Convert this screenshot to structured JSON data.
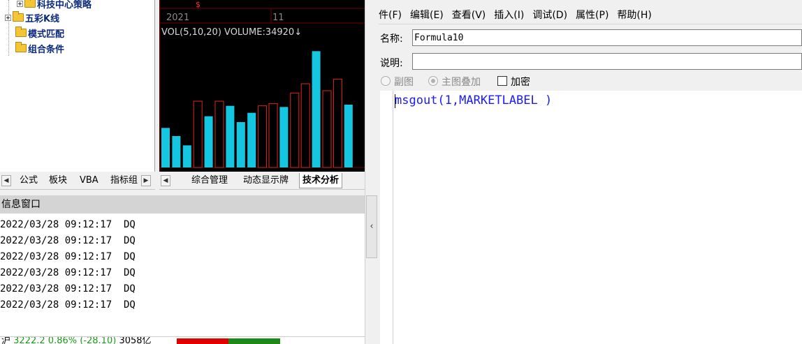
{
  "tree": {
    "items": [
      {
        "label": "科技中心策略",
        "expander": true
      },
      {
        "label": "五彩K线",
        "expander": true
      },
      {
        "label": "模式匹配",
        "expander": false
      },
      {
        "label": "组合条件",
        "expander": false
      }
    ]
  },
  "chart": {
    "year_label": "2021",
    "month_label": "11",
    "marker": "$",
    "indicator": "VOL(5,10,20) VOLUME:34920↓",
    "colors": {
      "up": "#e0251b",
      "down": "#15c6e0",
      "grid": "#7a0000"
    }
  },
  "chart_data": {
    "type": "bar",
    "series_name": "VOLUME",
    "bars": [
      {
        "value": 34,
        "kind": "down"
      },
      {
        "value": 27,
        "kind": "down"
      },
      {
        "value": 19,
        "kind": "down"
      },
      {
        "value": 57,
        "kind": "up"
      },
      {
        "value": 44,
        "kind": "down"
      },
      {
        "value": 57,
        "kind": "up"
      },
      {
        "value": 53,
        "kind": "down"
      },
      {
        "value": 39,
        "kind": "down"
      },
      {
        "value": 47,
        "kind": "down"
      },
      {
        "value": 53,
        "kind": "up"
      },
      {
        "value": 55,
        "kind": "up"
      },
      {
        "value": 52,
        "kind": "down"
      },
      {
        "value": 64,
        "kind": "up"
      },
      {
        "value": 72,
        "kind": "up"
      },
      {
        "value": 100,
        "kind": "down"
      },
      {
        "value": 66,
        "kind": "up"
      },
      {
        "value": 76,
        "kind": "up"
      },
      {
        "value": 54,
        "kind": "down"
      }
    ],
    "ylim": [
      0,
      120
    ]
  },
  "left_tabs": {
    "items": [
      "公式",
      "板块",
      "VBA",
      "指标组"
    ],
    "scroll_left": "◀",
    "scroll_right": "▶"
  },
  "chart_tabs": {
    "scroll_left": "◀",
    "items": [
      {
        "label": "综合管理",
        "active": false
      },
      {
        "label": "动态显示牌",
        "active": false
      },
      {
        "label": "技术分析",
        "active": true
      }
    ]
  },
  "info": {
    "title": "信息窗口",
    "lines": [
      "2022/03/28 09:12:17  DQ",
      "2022/03/28 09:12:17  DQ",
      "2022/03/28 09:12:17  DQ",
      "2022/03/28 09:12:17  DQ",
      "2022/03/28 09:12:17  DQ",
      "2022/03/28 09:12:17  DQ"
    ]
  },
  "status": {
    "index_name": "沪",
    "index_value": "3222.2",
    "change_pct": "0.86%",
    "change_abs": "(-28.10)",
    "turnover": "3058亿",
    "colors": {
      "text_green": "#1a9a1a",
      "red_block": "#e00000",
      "green_block": "#1a8a1a"
    }
  },
  "splitter": {
    "arrow": "‹"
  },
  "editor": {
    "menu": [
      "文件(F)",
      "编辑(E)",
      "查看(V)",
      "插入(I)",
      "调试(D)",
      "属性(P)",
      "帮助(H)"
    ],
    "name_label": "名称:",
    "name_value": "Formula10",
    "desc_label": "说明:",
    "desc_value": "",
    "option_subchart": "副图",
    "option_overlay": "主图叠加",
    "option_encrypt": "加密",
    "code": {
      "func": "msgout",
      "args": "(1,",
      "const": "MARKETLABEL",
      "tail": " )"
    }
  }
}
